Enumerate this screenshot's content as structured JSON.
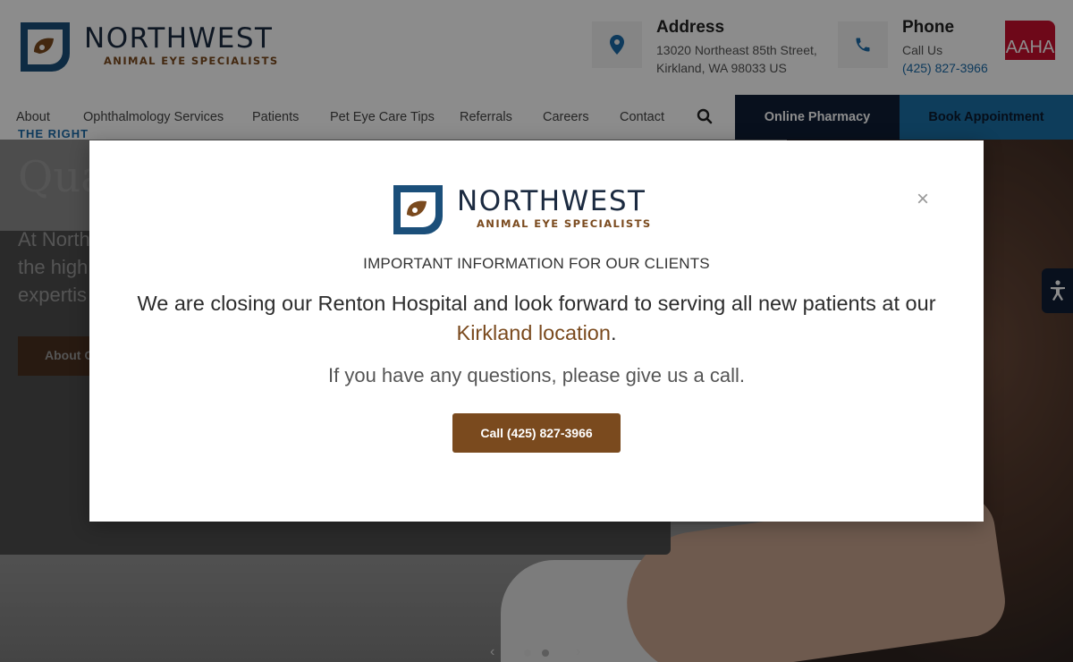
{
  "brand": {
    "name": "NORTHWEST",
    "tagline": "ANIMAL EYE SPECIALISTS",
    "colors": {
      "navy": "#1b2a40",
      "brown": "#7a4a1e",
      "blue": "#1a6aa8"
    }
  },
  "header": {
    "address": {
      "icon": "map-pin-icon",
      "title": "Address",
      "line1": "13020 Northeast 85th Street,",
      "line2": "Kirkland, WA 98033 US"
    },
    "phone": {
      "icon": "phone-icon",
      "title": "Phone",
      "line1": "Call Us",
      "number": "(425) 827-3966"
    },
    "aaha_badge": "AAHA"
  },
  "nav": {
    "items": [
      {
        "label": "About"
      },
      {
        "label": "Ophthalmology Services"
      },
      {
        "label": "Patients"
      },
      {
        "label": "Pet Eye Care Tips"
      },
      {
        "label": "Referrals"
      },
      {
        "label": "Careers"
      },
      {
        "label": "Contact"
      }
    ],
    "search_icon": "search-icon",
    "pharmacy_label": "Online Pharmacy",
    "book_label": "Book Appointment"
  },
  "hero": {
    "eyebrow": "THE RIGHT",
    "title": "Qua",
    "text": "At North the high expertis",
    "button_label": "About O",
    "slider": {
      "prev_icon": "chevron-left-icon",
      "next_icon": "chevron-right-icon",
      "active_index": 0,
      "total": 2
    }
  },
  "modal": {
    "close_label": "×",
    "heading": "IMPORTANT INFORMATION FOR OUR CLIENTS",
    "message_before": "We are closing our Renton Hospital and look forward to serving all new patients at our ",
    "message_link": "Kirkland location",
    "message_after": ".",
    "sub": "If you have any questions, please give us a call.",
    "call_label": "Call (425) 827-3966"
  }
}
